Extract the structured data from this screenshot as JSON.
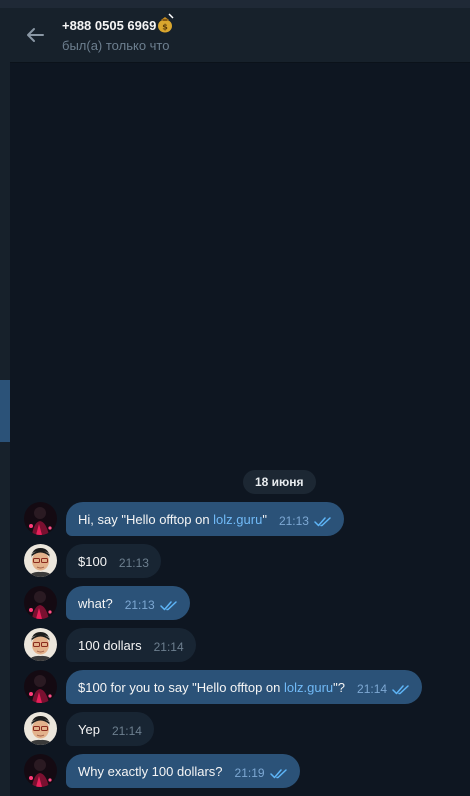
{
  "header": {
    "contact_name": "+888 0505 6969",
    "emoji_icon": "bag-of-money-emoji-icon",
    "status": "был(а) только что"
  },
  "chat": {
    "date_separator": "18 июня",
    "messages": [
      {
        "direction": "out",
        "parts": [
          "Hi, say \"Hello offtop on ",
          "lolz.guru",
          "\""
        ],
        "time": "21:13",
        "read": true
      },
      {
        "direction": "in",
        "parts": [
          "$100"
        ],
        "time": "21:13"
      },
      {
        "direction": "out",
        "parts": [
          "what?"
        ],
        "time": "21:13",
        "read": true
      },
      {
        "direction": "in",
        "parts": [
          "100 dollars"
        ],
        "time": "21:14"
      },
      {
        "direction": "out",
        "parts": [
          "$100 for you to say \"Hello offtop on ",
          "lolz.guru",
          "\"?"
        ],
        "time": "21:14",
        "read": true
      },
      {
        "direction": "in",
        "parts": [
          "Yep"
        ],
        "time": "21:14"
      },
      {
        "direction": "out",
        "parts": [
          "Why exactly 100 dollars?"
        ],
        "time": "21:19",
        "read": true
      }
    ]
  },
  "colors": {
    "background": "#0e1621",
    "header": "#17212b",
    "outgoing_bubble": "#2b5278",
    "incoming_bubble": "#182533",
    "link": "#71baf7",
    "read_check": "#5eb5f7"
  }
}
